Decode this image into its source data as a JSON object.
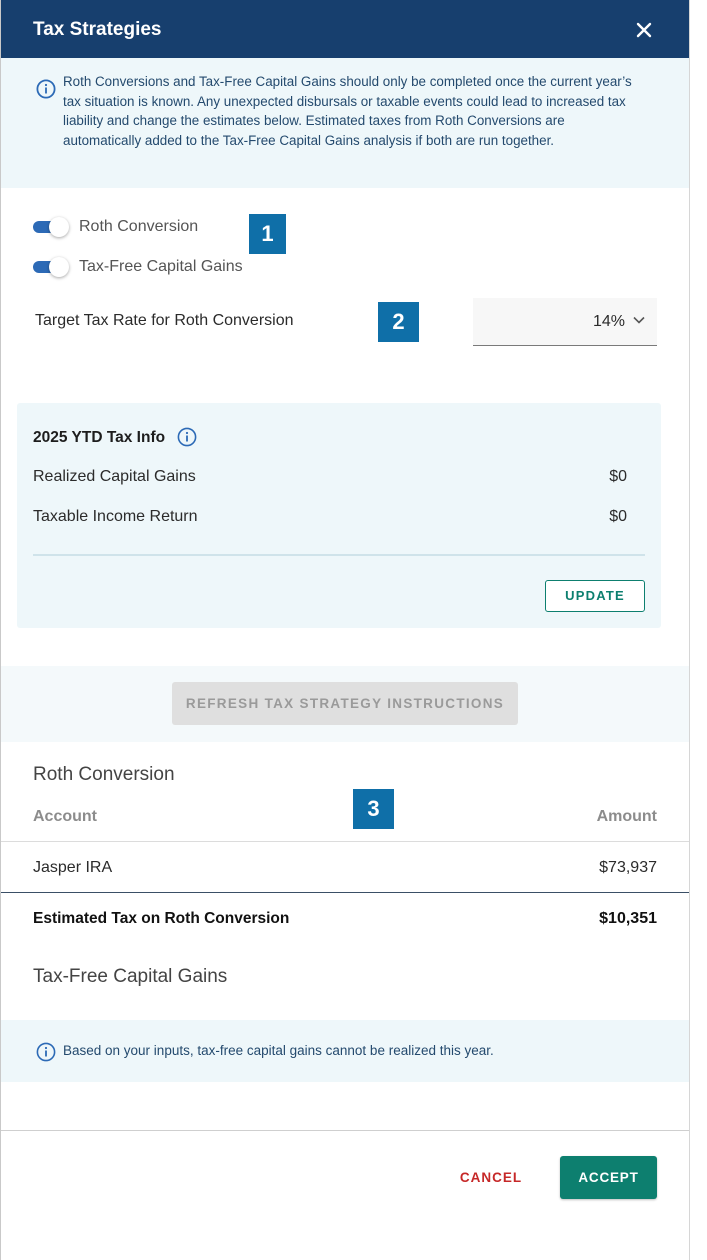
{
  "header": {
    "title": "Tax Strategies"
  },
  "info_banner": {
    "text": "Roth Conversions and Tax-Free Capital Gains should only be completed once the current year’s tax situation is known. Any unexpected disbursals or taxable events could lead to increased tax liability and change the estimates below. Estimated taxes from Roth Conversions are automatically added to the Tax-Free Capital Gains analysis if both are run together."
  },
  "toggles": [
    {
      "label": "Roth Conversion",
      "on": true
    },
    {
      "label": "Tax-Free Capital Gains",
      "on": true
    }
  ],
  "badges": [
    "1",
    "2",
    "3"
  ],
  "target_rate": {
    "label": "Target Tax Rate for Roth Conversion",
    "value": "14%"
  },
  "ytd": {
    "title": "2025 YTD Tax Info",
    "rows": [
      {
        "label": "Realized Capital Gains",
        "value": "$0"
      },
      {
        "label": "Taxable Income Return",
        "value": "$0"
      }
    ],
    "update_label": "UPDATE"
  },
  "refresh_label": "REFRESH TAX STRATEGY INSTRUCTIONS",
  "roth": {
    "title": "Roth Conversion",
    "columns": [
      "Account",
      "Amount"
    ],
    "rows": [
      {
        "account": "Jasper IRA",
        "amount": "$73,937"
      }
    ],
    "total_label": "Estimated Tax on Roth Conversion",
    "total_value": "$10,351"
  },
  "capital_gains": {
    "title": "Tax-Free Capital Gains",
    "message": "Based on your inputs, tax-free capital gains cannot be realized this year."
  },
  "footer": {
    "cancel_label": "CANCEL",
    "accept_label": "ACCEPT"
  },
  "colors": {
    "header_bg": "#173f6e",
    "accent_green": "#0d7f6f",
    "badge_blue": "#0f6fa8",
    "cancel_red": "#c62828",
    "info_bg": "#eef7fa"
  }
}
